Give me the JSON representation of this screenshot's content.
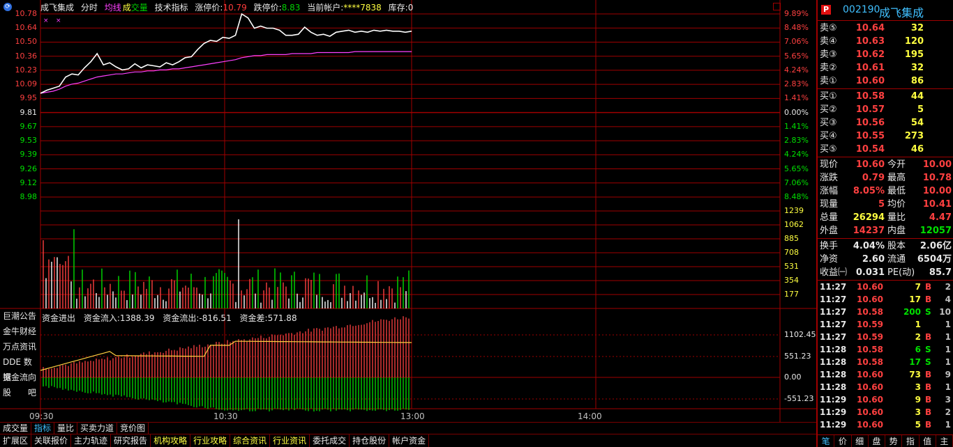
{
  "header": {
    "name": "成飞集成",
    "tab_minute": "分时",
    "legend_avg": "均线",
    "legend_vol_a": "成",
    "legend_vol_b": "交量",
    "tab_tech": "技术指标",
    "limit_up_label": "涨停价:",
    "limit_up_value": "10.79",
    "limit_down_label": "跌停价:",
    "limit_down_value": "8.83",
    "account_label": "当前帐户:",
    "account_value": "****7838",
    "stock_label": "库存:0"
  },
  "price_axis": {
    "left": [
      "10.78",
      "10.64",
      "10.50",
      "10.36",
      "10.23",
      "10.09",
      "9.95",
      "9.81",
      "9.67",
      "9.53",
      "9.39",
      "9.26",
      "9.12",
      "8.98"
    ],
    "right": [
      "9.89%",
      "8.48%",
      "7.06%",
      "5.65%",
      "4.24%",
      "2.83%",
      "1.41%",
      "0.00%",
      "1.41%",
      "2.83%",
      "4.24%",
      "5.65%",
      "7.06%",
      "8.48%"
    ]
  },
  "volume_axis": [
    "1239",
    "1062",
    "885",
    "708",
    "531",
    "354",
    "177"
  ],
  "flow_axis": [
    "1102.45",
    "551.23",
    "0.00",
    "-551.23"
  ],
  "time_axis": [
    "09:30",
    "10:30",
    "13:00",
    "14:00"
  ],
  "side_menu": [
    "巨潮公告",
    "金牛财经",
    "万点资讯",
    "DDE 数据",
    "资金流向",
    "股　　吧"
  ],
  "flow_header": {
    "title": "资金进出",
    "in_label": "资金流入:1388.39",
    "out_label": "资金流出:-816.51",
    "diff_label": "资金差:571.88"
  },
  "tabs_row1": [
    "成交量",
    "指标",
    "量比",
    "买卖力道",
    "竞价图"
  ],
  "tabs_row2": [
    "扩展区",
    "关联报价",
    "主力轨迹",
    "研究报告",
    "机构攻略",
    "行业攻略",
    "综合资讯",
    "行业资讯",
    "委托成交",
    "持仓股份",
    "帐户资金"
  ],
  "stock": {
    "code": "002190",
    "name": "成飞集成",
    "badge": "P"
  },
  "asks": [
    {
      "label": "卖⑤",
      "price": "10.64",
      "vol": "32"
    },
    {
      "label": "卖④",
      "price": "10.63",
      "vol": "120"
    },
    {
      "label": "卖③",
      "price": "10.62",
      "vol": "195"
    },
    {
      "label": "卖②",
      "price": "10.61",
      "vol": "32"
    },
    {
      "label": "卖①",
      "price": "10.60",
      "vol": "86"
    }
  ],
  "bids": [
    {
      "label": "买①",
      "price": "10.58",
      "vol": "44"
    },
    {
      "label": "买②",
      "price": "10.57",
      "vol": "5"
    },
    {
      "label": "买③",
      "price": "10.56",
      "vol": "54"
    },
    {
      "label": "买④",
      "price": "10.55",
      "vol": "273"
    },
    {
      "label": "买⑤",
      "price": "10.54",
      "vol": "46"
    }
  ],
  "quote": [
    {
      "k1": "现价",
      "v1": "10.60",
      "c1": "#ff4040",
      "k2": "今开",
      "v2": "10.00",
      "c2": "#ff4040"
    },
    {
      "k1": "涨跌",
      "v1": "0.79",
      "c1": "#ff4040",
      "k2": "最高",
      "v2": "10.78",
      "c2": "#ff4040"
    },
    {
      "k1": "涨幅",
      "v1": "8.05%",
      "c1": "#ff4040",
      "k2": "最低",
      "v2": "10.00",
      "c2": "#ff4040"
    },
    {
      "k1": "现量",
      "v1": "5",
      "c1": "#ff4040",
      "k2": "均价",
      "v2": "10.41",
      "c2": "#ff4040"
    },
    {
      "k1": "总量",
      "v1": "26294",
      "c1": "#ffff40",
      "k2": "量比",
      "v2": "4.47",
      "c2": "#ff4040"
    },
    {
      "k1": "外盘",
      "v1": "14237",
      "c1": "#ff4040",
      "k2": "内盘",
      "v2": "12057",
      "c2": "#00e000"
    }
  ],
  "quote2": [
    {
      "k1": "换手",
      "v1": "4.04%",
      "c1": "#e8e8e8",
      "k2": "股本",
      "v2": "2.06亿",
      "c2": "#e8e8e8"
    },
    {
      "k1": "净资",
      "v1": "2.60",
      "c1": "#e8e8e8",
      "k2": "流通",
      "v2": "6504万",
      "c2": "#e8e8e8"
    },
    {
      "k1": "收益㈠",
      "v1": "0.031",
      "c1": "#e8e8e8",
      "k2": "PE(动)",
      "v2": "85.7",
      "c2": "#e8e8e8"
    }
  ],
  "ticks": [
    {
      "t": "11:27",
      "p": "10.60",
      "v": "7",
      "d": "B",
      "n": "2"
    },
    {
      "t": "11:27",
      "p": "10.60",
      "v": "17",
      "d": "B",
      "n": "4"
    },
    {
      "t": "11:27",
      "p": "10.58",
      "v": "200",
      "d": "S",
      "n": "10"
    },
    {
      "t": "11:27",
      "p": "10.59",
      "v": "1",
      "d": "",
      "n": "1"
    },
    {
      "t": "11:27",
      "p": "10.59",
      "v": "2",
      "d": "B",
      "n": "1"
    },
    {
      "t": "11:28",
      "p": "10.58",
      "v": "6",
      "d": "S",
      "n": "1"
    },
    {
      "t": "11:28",
      "p": "10.58",
      "v": "17",
      "d": "S",
      "n": "1"
    },
    {
      "t": "11:28",
      "p": "10.60",
      "v": "73",
      "d": "B",
      "n": "9"
    },
    {
      "t": "11:28",
      "p": "10.60",
      "v": "3",
      "d": "B",
      "n": "1"
    },
    {
      "t": "11:29",
      "p": "10.60",
      "v": "9",
      "d": "B",
      "n": "3"
    },
    {
      "t": "11:29",
      "p": "10.60",
      "v": "3",
      "d": "B",
      "n": "2"
    },
    {
      "t": "11:29",
      "p": "10.60",
      "v": "5",
      "d": "B",
      "n": "1"
    }
  ],
  "rp_tabs": [
    "笔",
    "价",
    "细",
    "盘",
    "势",
    "指",
    "值",
    "主"
  ],
  "colors": {
    "up": "#ff4040",
    "down": "#00e000",
    "grid": "#a00000",
    "price_line": "#ffffff",
    "avg_line": "#ff40ff",
    "flow_line": "#ffd040",
    "accent": "#40c0ff"
  },
  "chart_data": {
    "type": "line",
    "title": "",
    "ylim": [
      8.98,
      10.78
    ],
    "base_price": 9.81,
    "series": [
      {
        "values": [
          10.0,
          10.03,
          10.05,
          10.07,
          10.16,
          10.19,
          10.18,
          10.25,
          10.31,
          10.39,
          10.28,
          10.3,
          10.26,
          10.23,
          10.24,
          10.29,
          10.25,
          10.28,
          10.27,
          10.26,
          10.3,
          10.28,
          10.31,
          10.35,
          10.36,
          10.43,
          10.49,
          10.52,
          10.51,
          10.55,
          10.54,
          10.57,
          10.78,
          10.74,
          10.64,
          10.66,
          10.64,
          10.64,
          10.62,
          10.57,
          10.57,
          10.58,
          10.65,
          10.6,
          10.57,
          10.58,
          10.56,
          10.6,
          10.61,
          10.62,
          10.6,
          10.61,
          10.6,
          10.62,
          10.61,
          10.62,
          10.61,
          10.61,
          10.6,
          10.61
        ]
      },
      {
        "values": [
          10.0,
          10.01,
          10.02,
          10.04,
          10.07,
          10.09,
          10.1,
          10.12,
          10.14,
          10.16,
          10.17,
          10.18,
          10.19,
          10.19,
          10.2,
          10.21,
          10.21,
          10.22,
          10.22,
          10.23,
          10.23,
          10.24,
          10.24,
          10.25,
          10.26,
          10.27,
          10.28,
          10.29,
          10.3,
          10.31,
          10.32,
          10.33,
          10.35,
          10.36,
          10.37,
          10.37,
          10.38,
          10.38,
          10.38,
          10.38,
          10.39,
          10.39,
          10.39,
          10.39,
          10.4,
          10.4,
          10.4,
          10.4,
          10.4,
          10.4,
          10.41,
          10.41,
          10.41,
          10.41,
          10.41,
          10.41,
          10.41,
          10.41,
          10.41,
          10.41
        ]
      }
    ]
  }
}
